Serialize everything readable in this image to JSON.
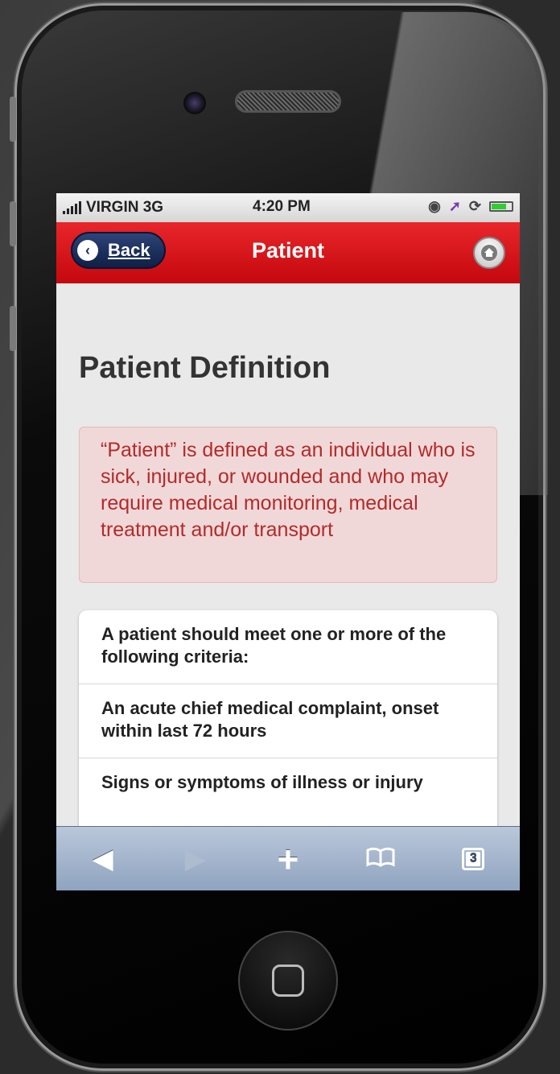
{
  "status_bar": {
    "carrier": "VIRGIN 3G",
    "time": "4:20 PM"
  },
  "nav": {
    "back_label": "Back",
    "title": "Patient"
  },
  "content": {
    "title": "Patient Definition",
    "definition": "“Patient” is defined as an individual who is sick, injured, or wounded and who may require medical monitoring, medical treatment and/or transport",
    "criteria": [
      "A patient should meet one or more of the following criteria:",
      "An acute chief medical complaint, onset within last 72 hours",
      "Signs or symptoms of illness or injury"
    ]
  },
  "toolbar": {
    "tabs_count": "3"
  },
  "icons": [
    "back-icon",
    "home-icon",
    "back-arrow-icon",
    "forward-arrow-icon",
    "add-icon",
    "bookmarks-icon",
    "tabs-icon",
    "alarm-icon",
    "location-icon",
    "rotation-lock-icon",
    "battery-icon",
    "signal-icon"
  ],
  "colors": {
    "nav_red": "#d4121a",
    "back_blue": "#1f3262",
    "definition_bg": "#f0d8d8",
    "definition_text": "#b42a2a",
    "toolbar_blue": "#a3b4cc"
  }
}
